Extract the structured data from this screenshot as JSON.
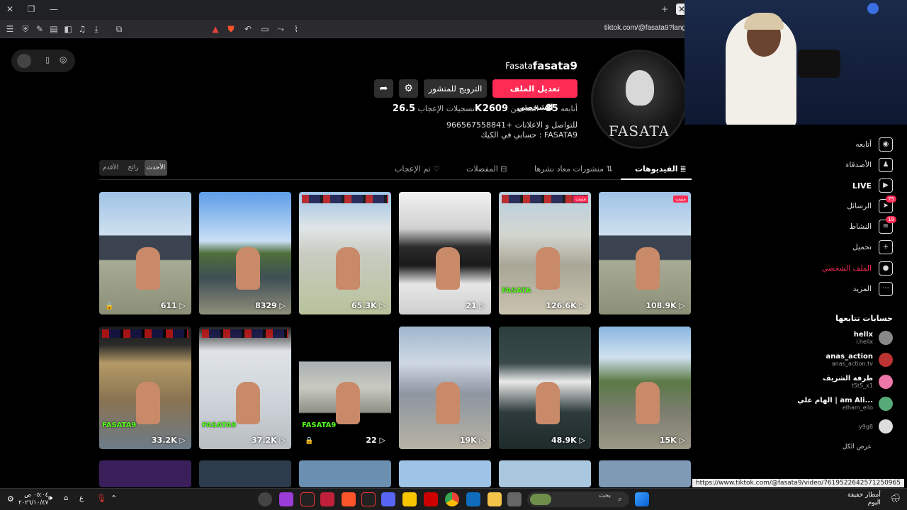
{
  "browser": {
    "url": "tiktok.com/@fasata9?lang",
    "status_url": "https://www.tiktok.com/@fasata9/video/7619522642571250965"
  },
  "profile": {
    "username": "fasata9",
    "nickname": "Fasata",
    "avatar_text": "FASATA",
    "edit_label": "تعديل الملف الشخصي",
    "promote_label": "الترويج للمنشور",
    "following_label": "أتابعه",
    "following_count": "85",
    "followers_label": "المتابعين",
    "followers_count": "2609",
    "likes_label": "تسجيلات الإعجاب",
    "likes_count": "26.5K",
    "bio_line1": "للتواصل و الاعلانات +966567558841",
    "bio_line2": "حسابي في الكيك : FASATA9"
  },
  "tabs": {
    "videos": "الفيديوهات",
    "reposts": "منشورات معاد نشرها",
    "favorites": "المفضلات",
    "liked": "تم الإعجاب",
    "sort": [
      "الأقدم",
      "رائج",
      "الأحدث"
    ]
  },
  "videos": [
    {
      "views": "611",
      "locked": true,
      "badge": "",
      "k": "",
      "bg": "linear-gradient(180deg,#9fc3e6 0%,#cfe0ef 35%,#3b4350 36%,#3b4350 55%,#a7ab95 56%,#8d9078 100%)"
    },
    {
      "views": "8329",
      "locked": false,
      "badge": "",
      "k": "",
      "bg": "linear-gradient(180deg,#5d9ee8 0%,#c9dff5 40%,#4f6f3a 50%,#3f4f55 70%,#8f8f7a 100%)"
    },
    {
      "views": "65.3K",
      "locked": false,
      "badge": "",
      "k": "",
      "hud": true,
      "bg": "linear-gradient(180deg,#9fc3e6 0%,#dfe5e6 30%,#c9ccc2 50%,#b7c29a 100%)"
    },
    {
      "views": "21",
      "locked": false,
      "badge": "",
      "k": "",
      "bg": "linear-gradient(180deg,#f2f2f2 0%,#d0d0d0 30%,#2a2a2a 45%,#1a1a1a 60%,#e6e6e6 75%,#cfcfcf 100%)"
    },
    {
      "views": "126.6K",
      "locked": false,
      "badge": "مثبت",
      "k": "FASATA",
      "hud": true,
      "bg": "linear-gradient(180deg,#b8cfe0 0%,#d3d6d0 35%,#a9a696 60%,#c9c4b0 100%)"
    },
    {
      "views": "108.9K",
      "locked": false,
      "badge": "مثبت",
      "k": "",
      "bg": "linear-gradient(180deg,#9fc3e6 0%,#cfe0ef 35%,#3b4350 36%,#3b4350 55%,#a7ab95 56%,#8d9078 100%)"
    },
    {
      "views": "33.2K",
      "locked": false,
      "badge": "",
      "k": "FASATA9",
      "hud": true,
      "bg": "linear-gradient(180deg,#1b1b1b 0%,#2a2a2a 15%,#b39a66 30%,#8a7352 60%,#6c7b88 100%)"
    },
    {
      "views": "37.2K",
      "locked": false,
      "badge": "",
      "k": "FASATA9",
      "hud": true,
      "bg": "linear-gradient(180deg,#1b1b1b 0%,#dfe3e8 20%,#cfd4da 60%,#b8bdc2 100%)"
    },
    {
      "views": "22",
      "locked": true,
      "badge": "",
      "k": "FASATA9",
      "bg": "linear-gradient(180deg,#000 0%,#000 28%,#a9b0b2 29%,#c9c9c0 50%,#8d8f85 70%,#000 71%,#000 100%)"
    },
    {
      "views": "19K",
      "locked": false,
      "badge": "",
      "k": "",
      "bg": "linear-gradient(180deg,#9fb7cf 0%,#cfd8e2 30%,#8d96a0 55%,#b8b2a4 100%)"
    },
    {
      "views": "48.9K",
      "locked": false,
      "badge": "",
      "k": "",
      "bg": "linear-gradient(180deg,#2c3e3e 0%,#3a4a4a 30%,#e9e9e9 45%,#2e3b3c 70%,#1f2a2a 100%)"
    },
    {
      "views": "15K",
      "locked": false,
      "badge": "",
      "k": "",
      "bg": "linear-gradient(180deg,#8bb6e0 0%,#cfe0ef 25%,#5b7a45 45%,#7d7d70 70%,#9b9886 100%)"
    }
  ],
  "sidebar": {
    "items": [
      {
        "label": "أتابعه",
        "icon": "following-icon",
        "glyph": "◉",
        "count": ""
      },
      {
        "label": "الأصدقاء",
        "icon": "friends-icon",
        "glyph": "♟",
        "count": ""
      },
      {
        "label": "LIVE",
        "icon": "live-icon",
        "glyph": "▶",
        "count": ""
      },
      {
        "label": "الرسائل",
        "icon": "messages-icon",
        "glyph": "➤",
        "count": "75"
      },
      {
        "label": "النشاط",
        "icon": "activity-icon",
        "glyph": "≡",
        "count": "19"
      },
      {
        "label": "تحميل",
        "icon": "upload-icon",
        "glyph": "+",
        "count": ""
      },
      {
        "label": "الملف الشخصي",
        "icon": "profile-icon",
        "glyph": "●",
        "count": ""
      },
      {
        "label": "المزيد",
        "icon": "more-icon",
        "glyph": "···",
        "count": ""
      }
    ],
    "following_title": "حسابات تتابعها",
    "accounts": [
      {
        "name": "hellx",
        "handle": "i.hellx"
      },
      {
        "name": "anas_action",
        "handle": "anas_action.tv"
      },
      {
        "name": "طرفة الشريف",
        "handle": "t5t5_x1"
      },
      {
        "name": "الهام علي | am Ali...",
        "handle": "elham_ello"
      },
      {
        "name": "",
        "handle": "y9g8"
      }
    ],
    "see_all": "عرض الكل"
  },
  "taskbar": {
    "time": "٠٥:٠٤ ص",
    "date": "٢٠٢٦/١٠/٤٧",
    "search_placeholder": "بحث",
    "weather": "أمطار خفيفة",
    "weather_sub": "اليوم",
    "lang": "ع"
  }
}
